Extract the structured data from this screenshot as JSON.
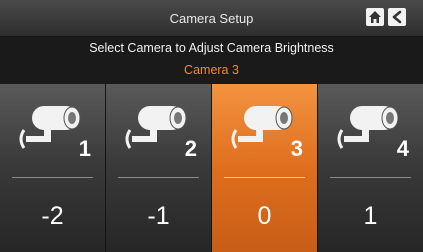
{
  "header": {
    "title": "Camera Setup",
    "home_icon": "home-icon",
    "back_icon": "back-arrow-icon"
  },
  "subtitle": "Select Camera to Adjust Camera Brightness",
  "selected_camera": "Camera 3",
  "colors": {
    "accent": "#e07020",
    "selected_text": "#f08a2c"
  },
  "cameras": [
    {
      "number": "1",
      "brightness": "-2",
      "selected": false
    },
    {
      "number": "2",
      "brightness": "-1",
      "selected": false
    },
    {
      "number": "3",
      "brightness": "0",
      "selected": true
    },
    {
      "number": "4",
      "brightness": "1",
      "selected": false
    }
  ]
}
